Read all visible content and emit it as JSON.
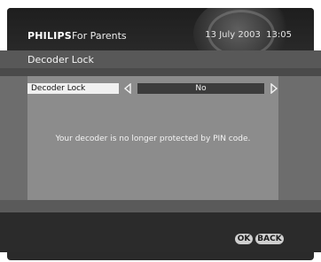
{
  "header": {
    "brand": "PHILIPS",
    "section": "For Parents",
    "date": "13 July 2003",
    "time": "13:05"
  },
  "title": "Decoder Lock",
  "setting": {
    "label": "Decoder Lock",
    "value": "No"
  },
  "message": "Your decoder is no longer protected by PIN code.",
  "buttons": {
    "ok": "OK",
    "back": "BACK"
  },
  "icons": {
    "left": "left-arrow-icon",
    "right": "right-arrow-icon"
  }
}
